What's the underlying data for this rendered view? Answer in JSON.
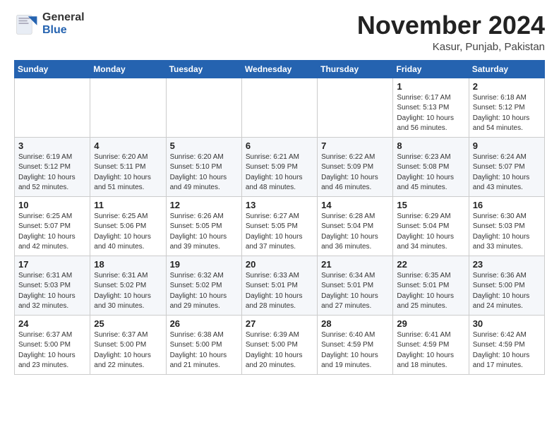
{
  "header": {
    "logo_general": "General",
    "logo_blue": "Blue",
    "month_title": "November 2024",
    "subtitle": "Kasur, Punjab, Pakistan"
  },
  "weekdays": [
    "Sunday",
    "Monday",
    "Tuesday",
    "Wednesday",
    "Thursday",
    "Friday",
    "Saturday"
  ],
  "weeks": [
    [
      {
        "day": "",
        "info": ""
      },
      {
        "day": "",
        "info": ""
      },
      {
        "day": "",
        "info": ""
      },
      {
        "day": "",
        "info": ""
      },
      {
        "day": "",
        "info": ""
      },
      {
        "day": "1",
        "info": "Sunrise: 6:17 AM\nSunset: 5:13 PM\nDaylight: 10 hours and 56 minutes."
      },
      {
        "day": "2",
        "info": "Sunrise: 6:18 AM\nSunset: 5:12 PM\nDaylight: 10 hours and 54 minutes."
      }
    ],
    [
      {
        "day": "3",
        "info": "Sunrise: 6:19 AM\nSunset: 5:12 PM\nDaylight: 10 hours and 52 minutes."
      },
      {
        "day": "4",
        "info": "Sunrise: 6:20 AM\nSunset: 5:11 PM\nDaylight: 10 hours and 51 minutes."
      },
      {
        "day": "5",
        "info": "Sunrise: 6:20 AM\nSunset: 5:10 PM\nDaylight: 10 hours and 49 minutes."
      },
      {
        "day": "6",
        "info": "Sunrise: 6:21 AM\nSunset: 5:09 PM\nDaylight: 10 hours and 48 minutes."
      },
      {
        "day": "7",
        "info": "Sunrise: 6:22 AM\nSunset: 5:09 PM\nDaylight: 10 hours and 46 minutes."
      },
      {
        "day": "8",
        "info": "Sunrise: 6:23 AM\nSunset: 5:08 PM\nDaylight: 10 hours and 45 minutes."
      },
      {
        "day": "9",
        "info": "Sunrise: 6:24 AM\nSunset: 5:07 PM\nDaylight: 10 hours and 43 minutes."
      }
    ],
    [
      {
        "day": "10",
        "info": "Sunrise: 6:25 AM\nSunset: 5:07 PM\nDaylight: 10 hours and 42 minutes."
      },
      {
        "day": "11",
        "info": "Sunrise: 6:25 AM\nSunset: 5:06 PM\nDaylight: 10 hours and 40 minutes."
      },
      {
        "day": "12",
        "info": "Sunrise: 6:26 AM\nSunset: 5:05 PM\nDaylight: 10 hours and 39 minutes."
      },
      {
        "day": "13",
        "info": "Sunrise: 6:27 AM\nSunset: 5:05 PM\nDaylight: 10 hours and 37 minutes."
      },
      {
        "day": "14",
        "info": "Sunrise: 6:28 AM\nSunset: 5:04 PM\nDaylight: 10 hours and 36 minutes."
      },
      {
        "day": "15",
        "info": "Sunrise: 6:29 AM\nSunset: 5:04 PM\nDaylight: 10 hours and 34 minutes."
      },
      {
        "day": "16",
        "info": "Sunrise: 6:30 AM\nSunset: 5:03 PM\nDaylight: 10 hours and 33 minutes."
      }
    ],
    [
      {
        "day": "17",
        "info": "Sunrise: 6:31 AM\nSunset: 5:03 PM\nDaylight: 10 hours and 32 minutes."
      },
      {
        "day": "18",
        "info": "Sunrise: 6:31 AM\nSunset: 5:02 PM\nDaylight: 10 hours and 30 minutes."
      },
      {
        "day": "19",
        "info": "Sunrise: 6:32 AM\nSunset: 5:02 PM\nDaylight: 10 hours and 29 minutes."
      },
      {
        "day": "20",
        "info": "Sunrise: 6:33 AM\nSunset: 5:01 PM\nDaylight: 10 hours and 28 minutes."
      },
      {
        "day": "21",
        "info": "Sunrise: 6:34 AM\nSunset: 5:01 PM\nDaylight: 10 hours and 27 minutes."
      },
      {
        "day": "22",
        "info": "Sunrise: 6:35 AM\nSunset: 5:01 PM\nDaylight: 10 hours and 25 minutes."
      },
      {
        "day": "23",
        "info": "Sunrise: 6:36 AM\nSunset: 5:00 PM\nDaylight: 10 hours and 24 minutes."
      }
    ],
    [
      {
        "day": "24",
        "info": "Sunrise: 6:37 AM\nSunset: 5:00 PM\nDaylight: 10 hours and 23 minutes."
      },
      {
        "day": "25",
        "info": "Sunrise: 6:37 AM\nSunset: 5:00 PM\nDaylight: 10 hours and 22 minutes."
      },
      {
        "day": "26",
        "info": "Sunrise: 6:38 AM\nSunset: 5:00 PM\nDaylight: 10 hours and 21 minutes."
      },
      {
        "day": "27",
        "info": "Sunrise: 6:39 AM\nSunset: 5:00 PM\nDaylight: 10 hours and 20 minutes."
      },
      {
        "day": "28",
        "info": "Sunrise: 6:40 AM\nSunset: 4:59 PM\nDaylight: 10 hours and 19 minutes."
      },
      {
        "day": "29",
        "info": "Sunrise: 6:41 AM\nSunset: 4:59 PM\nDaylight: 10 hours and 18 minutes."
      },
      {
        "day": "30",
        "info": "Sunrise: 6:42 AM\nSunset: 4:59 PM\nDaylight: 10 hours and 17 minutes."
      }
    ]
  ]
}
